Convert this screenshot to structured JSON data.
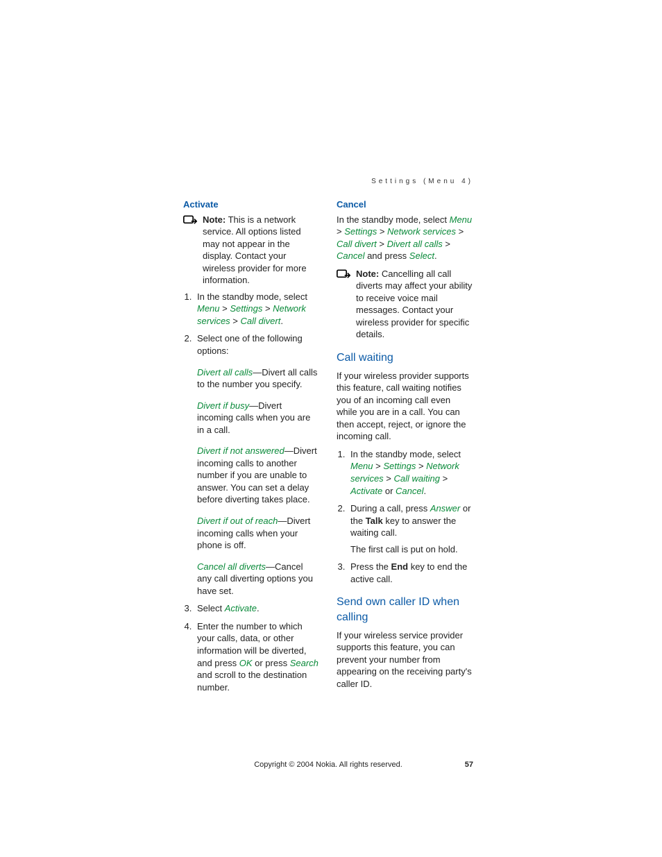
{
  "header": "Settings (Menu 4)",
  "left": {
    "activate": {
      "title": "Activate",
      "noteLabel": "Note:",
      "noteText": " This is a network service. All options listed may not appear in the display. Contact your wireless provider for more information.",
      "step1_pre": "In the standby mode, select ",
      "m_menu": "Menu",
      "gt": " > ",
      "m_settings": "Settings",
      "m_network": "Network services",
      "m_calldivert": "Call divert",
      "step1_end": ".",
      "step2": "Select one of the following options:",
      "opt1_t": "Divert all calls",
      "opt1_d": "—Divert all calls to the number you specify.",
      "opt2_t": "Divert if busy",
      "opt2_d": "—Divert incoming calls when you are in a call.",
      "opt3_t": "Divert if not answered",
      "opt3_d": "—Divert incoming calls to another number if you are unable to answer. You can set a delay before diverting takes place.",
      "opt4_t": "Divert if out of reach",
      "opt4_d": "—Divert incoming calls when your phone is off.",
      "opt5_t": "Cancel all diverts",
      "opt5_d": "—Cancel any call diverting options you have set.",
      "step3_pre": "Select ",
      "step3_act": "Activate",
      "step3_end": ".",
      "step4_a": "Enter the number to which your calls, data, or other information will be diverted, and press ",
      "step4_ok": "OK",
      "step4_b": " or press ",
      "step4_search": "Search",
      "step4_c": " and scroll to the destination number."
    }
  },
  "right": {
    "cancel": {
      "title": "Cancel",
      "p_a": "In the standby mode, select ",
      "m_menu": "Menu",
      "gt": " > ",
      "m_settings": "Settings",
      "m_network": "Network services",
      "m_calldivert": "Call divert",
      "m_divertall": "Divert all calls",
      "m_cancel": "Cancel",
      "p_b": " and press ",
      "m_select": "Select",
      "p_c": ".",
      "noteLabel": "Note:",
      "noteText": " Cancelling all call diverts may affect your ability to receive voice mail messages. Contact your wireless provider for specific details."
    },
    "callwaiting": {
      "title": "Call waiting",
      "intro": "If your wireless provider supports this feature, call waiting notifies you of an incoming call even while you are in a call. You can then accept, reject, or ignore the incoming call.",
      "s1_a": "In the standby mode, select ",
      "m_menu": "Menu",
      "gt": " > ",
      "m_settings": "Settings",
      "m_network": "Network services",
      "m_callwaiting": "Call waiting",
      "m_activate": "Activate",
      "s1_or": " or ",
      "m_cancel": "Cancel",
      "s1_end": ".",
      "s2_a": "During a call, press ",
      "m_answer": "Answer",
      "s2_b": " or the ",
      "s2_talk": "Talk",
      "s2_c": " key to answer the waiting call.",
      "s2_note": "The first call is put on hold.",
      "s3_a": "Press the ",
      "s3_end": "End",
      "s3_b": " key to end the active call."
    },
    "callerid": {
      "title": "Send own caller ID when calling",
      "body": "If your wireless service provider supports this feature, you can prevent your number from appearing on the receiving party's caller ID."
    }
  },
  "footer": {
    "copy": "Copyright © 2004 Nokia. All rights reserved.",
    "page": "57"
  }
}
